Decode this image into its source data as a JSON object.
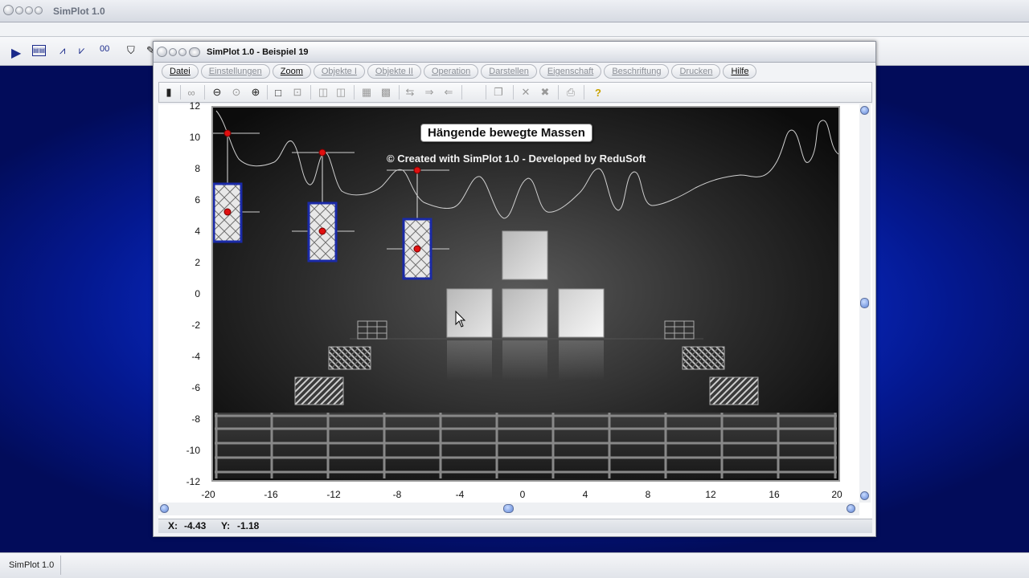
{
  "outer": {
    "title": "SimPlot 1.0",
    "taskbar_item": "SimPlot 1.0"
  },
  "window": {
    "title": "SimPlot 1.0 - Beispiel 19"
  },
  "menu": [
    {
      "label": "Datei",
      "enabled": true
    },
    {
      "label": "Einstellungen",
      "enabled": false
    },
    {
      "label": "Zoom",
      "enabled": true
    },
    {
      "label": "Objekte I",
      "enabled": false
    },
    {
      "label": "Objekte II",
      "enabled": false
    },
    {
      "label": "Operation",
      "enabled": false
    },
    {
      "label": "Darstellen",
      "enabled": false
    },
    {
      "label": "Eigenschaft",
      "enabled": false
    },
    {
      "label": "Beschriftung",
      "enabled": false
    },
    {
      "label": "Drucken",
      "enabled": false
    },
    {
      "label": "Hilfe",
      "enabled": true
    }
  ],
  "plot": {
    "title": "Hängende bewegte Massen",
    "copyright": "© Created with SimPlot 1.0 - Developed by ReduSoft",
    "x_ticks": [
      "-20",
      "-16",
      "-12",
      "-8",
      "-4",
      "0",
      "4",
      "8",
      "12",
      "16",
      "20"
    ],
    "y_ticks": [
      "12",
      "10",
      "8",
      "6",
      "4",
      "2",
      "0",
      "-2",
      "-4",
      "-6",
      "-8",
      "-10",
      "-12"
    ],
    "xlim": [
      -20,
      20
    ],
    "ylim": [
      -12,
      12
    ],
    "background_colors": [
      "#5a5a5a",
      "#0c0c0c"
    ],
    "curve_color": "#cfcfcf",
    "mass_border_color": "#1a2aa8",
    "marker_color": "#e01010"
  },
  "status": {
    "x_label": "X:",
    "x_value": "-4.43",
    "y_label": "Y:",
    "y_value": "-1.18"
  }
}
